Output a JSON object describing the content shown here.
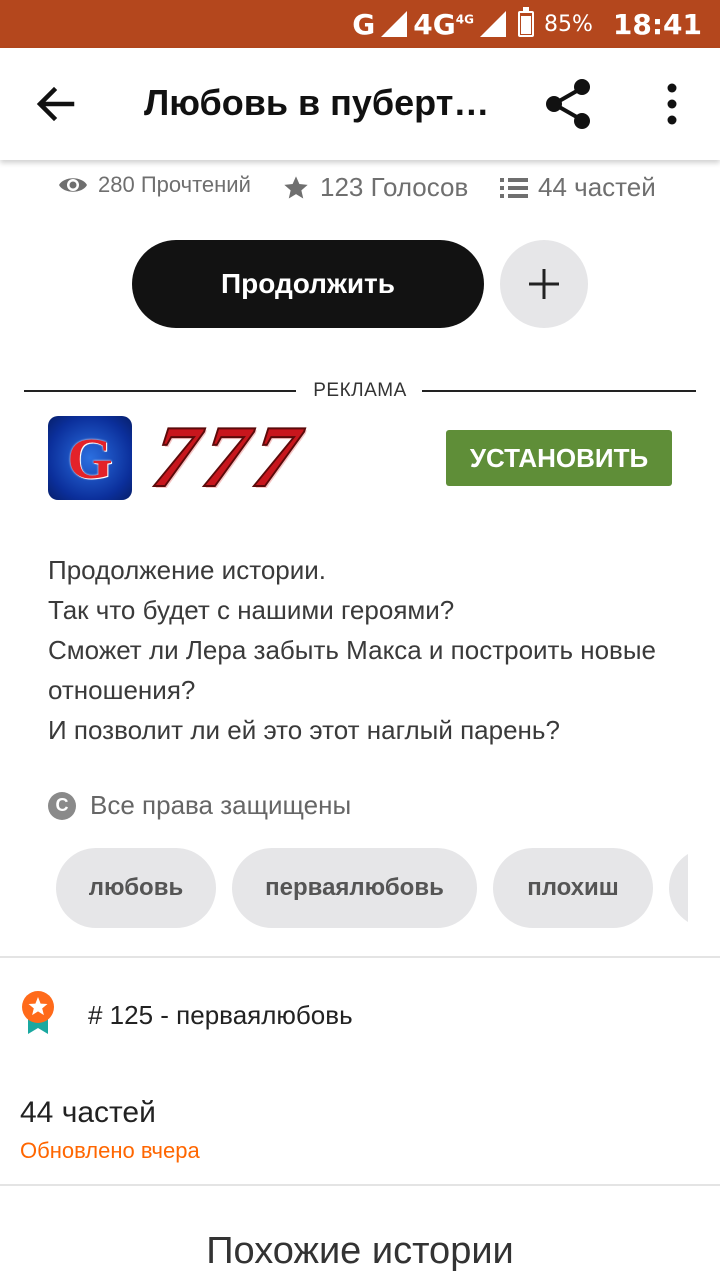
{
  "status_bar": {
    "network": "G",
    "network_4g": "4G",
    "network_4g_sup": "4G",
    "battery_percent": "85%",
    "time": "18:41"
  },
  "app_bar": {
    "title": "Любовь в пуберт…"
  },
  "stats": {
    "reads": "280 Прочтений",
    "votes": "123 Голосов",
    "parts": "44 частей"
  },
  "actions": {
    "continue_label": "Продолжить"
  },
  "ad": {
    "label": "РЕКЛАМА",
    "icon_letter": "G",
    "sevens": [
      "7",
      "7",
      "7"
    ],
    "install_label": "УСТАНОВИТЬ"
  },
  "description": [
    "Продолжение истории.",
    "Так что будет с нашими героями?",
    "Сможет ли Лера забыть Макса и построить новые отношения?",
    "И позволит ли ей это этот наглый парень?"
  ],
  "rights": {
    "icon_letter": "C",
    "text": "Все права защищены"
  },
  "tags": [
    "любовь",
    "перваялюбовь",
    "плохиш",
    ""
  ],
  "ranking": {
    "text": "# 125 - перваялюбовь"
  },
  "parts_section": {
    "title": "44 частей",
    "updated": "Обновлено вчера"
  },
  "similar": {
    "heading": "Похожие истории"
  },
  "colors": {
    "status_bar": "#b4471d",
    "install_button": "#5f8e38",
    "updated_text": "#ff6600",
    "continue_button": "#121212"
  }
}
